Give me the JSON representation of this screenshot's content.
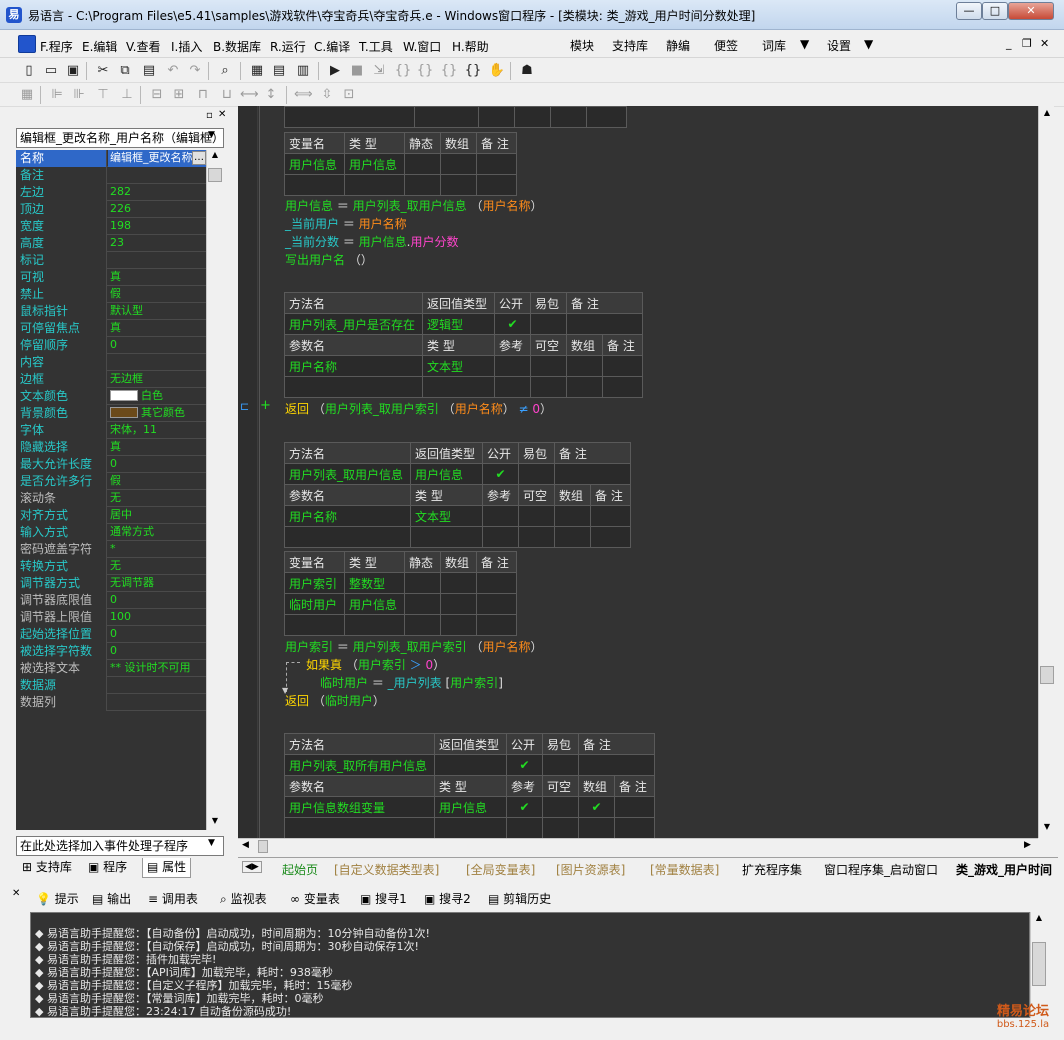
{
  "window": {
    "title": "易语言 - C:\\Program Files\\e5.41\\samples\\游戏软件\\夺宝奇兵\\夺宝奇兵.e - Windows窗口程序 - [类模块: 类_游戏_用户时间分数处理]",
    "min": "—",
    "max": "□",
    "close": "✕"
  },
  "menu": {
    "items": [
      "F.程序",
      "E.编辑",
      "V.查看",
      "I.插入",
      "B.数据库",
      "R.运行",
      "C.编译",
      "T.工具",
      "W.窗口",
      "H.帮助"
    ],
    "right": [
      "模块",
      "支持库",
      "静编",
      "便签",
      "词库",
      "设置"
    ]
  },
  "left": {
    "combo": "编辑框_更改名称_用户名称（编辑框）",
    "props": [
      {
        "name": "名称",
        "value": "编辑框_更改名称",
        "sel": true
      },
      {
        "name": "备注",
        "value": ""
      },
      {
        "name": "左边",
        "value": "282"
      },
      {
        "name": "顶边",
        "value": "226"
      },
      {
        "name": "宽度",
        "value": "198"
      },
      {
        "name": "高度",
        "value": "23"
      },
      {
        "name": "标记",
        "value": ""
      },
      {
        "name": "可视",
        "value": "真"
      },
      {
        "name": "禁止",
        "value": "假"
      },
      {
        "name": "鼠标指针",
        "value": "默认型"
      },
      {
        "name": "可停留焦点",
        "value": "真"
      },
      {
        "name": "  停留顺序",
        "value": "0"
      },
      {
        "name": "内容",
        "value": ""
      },
      {
        "name": "边框",
        "value": "无边框"
      },
      {
        "name": "文本颜色",
        "value": "白色",
        "swatch": "#ffffff"
      },
      {
        "name": "背景颜色",
        "value": "其它颜色",
        "swatch": "#6b4a1a"
      },
      {
        "name": "字体",
        "value": "宋体，11"
      },
      {
        "name": "隐藏选择",
        "value": "真"
      },
      {
        "name": "最大允许长度",
        "value": "0"
      },
      {
        "name": "是否允许多行",
        "value": "假"
      },
      {
        "name": "滚动条",
        "value": "无",
        "dim": true
      },
      {
        "name": "对齐方式",
        "value": "居中"
      },
      {
        "name": "输入方式",
        "value": "通常方式"
      },
      {
        "name": "  密码遮盖字符",
        "value": "*",
        "dim": true
      },
      {
        "name": "转换方式",
        "value": "无"
      },
      {
        "name": "调节器方式",
        "value": "无调节器"
      },
      {
        "name": "  调节器底限值",
        "value": "0",
        "dim": true
      },
      {
        "name": "  调节器上限值",
        "value": "100",
        "dim": true
      },
      {
        "name": "起始选择位置",
        "value": "0"
      },
      {
        "name": "被选择字符数",
        "value": "0"
      },
      {
        "name": "被选择文本",
        "value": "** 设计时不可用",
        "dim": true
      },
      {
        "name": "数据源",
        "value": ""
      },
      {
        "name": "数据列",
        "value": "",
        "dim": true
      }
    ],
    "event_combo": "在此处选择加入事件处理子程序",
    "tabs": [
      "支持库",
      "程序",
      "属性"
    ]
  },
  "code": {
    "t1_head": [
      "变量名",
      "类 型",
      "静态",
      "数组",
      "备 注"
    ],
    "t1_row": [
      "用户信息",
      "用户信息"
    ],
    "l1": [
      "用户信息",
      " ＝ ",
      "用户列表_取用户信息",
      " （",
      "用户名称",
      "）"
    ],
    "l2": [
      "_当前用户",
      " ＝ ",
      "用户名称"
    ],
    "l3": [
      "_当前分数",
      " ＝ ",
      "用户信息",
      ".",
      "用户分数"
    ],
    "l4": [
      "写出用户名",
      " （）"
    ],
    "m1_head": [
      "方法名",
      "返回值类型",
      "公开",
      "易包",
      "备 注"
    ],
    "m1_row": [
      "用户列表_用户是否存在",
      "逻辑型",
      "✔"
    ],
    "p_head": [
      "参数名",
      "类 型",
      "参考",
      "可空",
      "数组",
      "备 注"
    ],
    "m1_param": [
      "用户名称",
      "文本型"
    ],
    "l5": [
      "返回",
      " （",
      "用户列表_取用户索引",
      " （",
      "用户名称",
      "）",
      " ≠ ",
      "0",
      "）"
    ],
    "m2_row": [
      "用户列表_取用户信息",
      "用户信息",
      "✔"
    ],
    "m2_param": [
      "用户名称",
      "文本型"
    ],
    "t2_row1": [
      "用户索引",
      "整数型"
    ],
    "t2_row2": [
      "临时用户",
      "用户信息"
    ],
    "l6": [
      "用户索引",
      " ＝ ",
      "用户列表_取用户索引",
      " （",
      "用户名称",
      "）"
    ],
    "l7": [
      "如果真",
      " （",
      "用户索引",
      " ＞ ",
      "0",
      "）"
    ],
    "l8": [
      "临时用户",
      " ＝ ",
      "_用户列表",
      " [",
      "用户索引",
      "]"
    ],
    "l9": [
      "返回",
      " （",
      "临时用户",
      "）"
    ],
    "m3_row": [
      "用户列表_取所有用户信息",
      "",
      "✔"
    ],
    "m3_param": [
      "用户信息数组变量",
      "用户信息",
      "✔",
      "",
      "✔"
    ]
  },
  "bottom_tabs": [
    "起始页",
    "[自定义数据类型表]",
    "[全局变量表]",
    "[图片资源表]",
    "[常量数据表]",
    "扩充程序集",
    "窗口程序集_启动窗口",
    "类_游戏_用户时间"
  ],
  "output": {
    "tabs": [
      "提示",
      "输出",
      "调用表",
      "监视表",
      "变量表",
      "搜寻1",
      "搜寻2",
      "剪辑历史"
    ],
    "lines": [
      "◆ 易语言助手提醒您：【自动备份】启动成功，时间周期为：10分钟自动备份1次!",
      "◆ 易语言助手提醒您：【自动保存】启动成功，时间周期为：30秒自动保存1次!",
      "◆ 易语言助手提醒您：插件加载完毕!",
      "◆ 易语言助手提醒您：【API词库】加载完毕，耗时：938毫秒",
      "◆ 易语言助手提醒您：【自定义子程序】加载完毕，耗时：15毫秒",
      "◆ 易语言助手提醒您：【常量词库】加载完毕，耗时：0毫秒",
      "◆ 易语言助手提醒您：23:24:17 自动备份源码成功!"
    ]
  },
  "watermark": {
    "line1": "精易论坛",
    "line2": "bbs.125.la"
  }
}
